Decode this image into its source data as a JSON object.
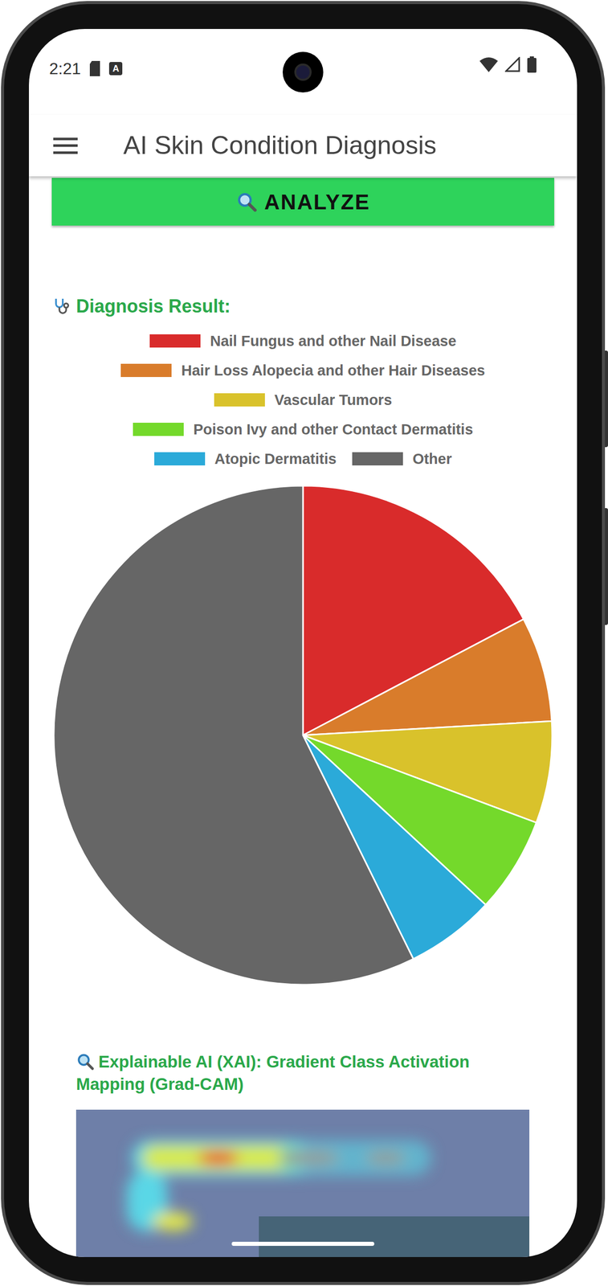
{
  "status_bar": {
    "time": "2:21",
    "notification_badge": "A"
  },
  "app_bar": {
    "title": "AI Skin Condition Diagnosis"
  },
  "analyze_button": {
    "label": "ANALYZE"
  },
  "result": {
    "heading": "Diagnosis Result:",
    "chart": {
      "series": [
        {
          "label": "Nail Fungus and other Nail Disease",
          "value": 17.3,
          "color": "#d92b2b"
        },
        {
          "label": "Hair Loss Alopecia and other Hair Diseases",
          "value": 6.8,
          "color": "#d97c2b"
        },
        {
          "label": "Vascular Tumors",
          "value": 6.6,
          "color": "#d9c22b"
        },
        {
          "label": "Poison Ivy and other Contact Dermatitis",
          "value": 6.2,
          "color": "#74d92b"
        },
        {
          "label": "Atopic Dermatitis",
          "value": 5.8,
          "color": "#2baad9"
        },
        {
          "label": "Other",
          "value": 57.3,
          "color": "#666666"
        }
      ]
    }
  },
  "xai": {
    "heading": "Explainable AI (XAI): Gradient Class Activation Mapping (Grad-CAM)"
  }
}
